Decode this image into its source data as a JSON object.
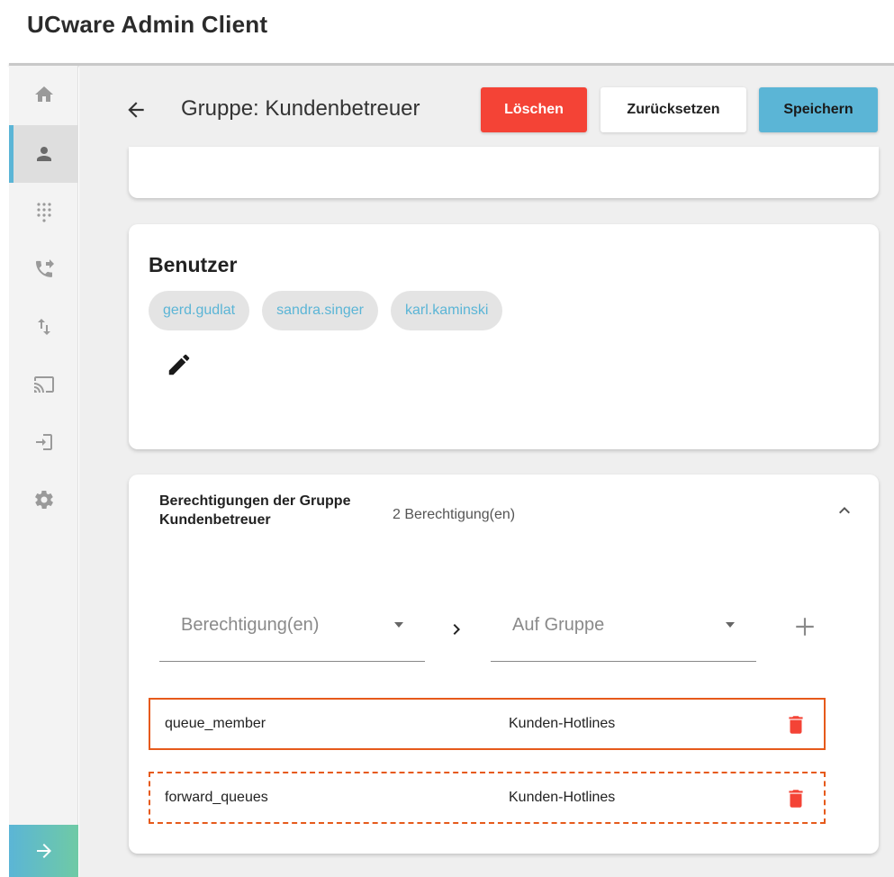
{
  "app": {
    "title": "UCware Admin Client"
  },
  "sidebar": {
    "items": [
      {
        "icon": "home-icon",
        "active": false
      },
      {
        "icon": "user-icon",
        "active": true
      },
      {
        "icon": "dialpad-icon",
        "active": false
      },
      {
        "icon": "phone-forward-icon",
        "active": false
      },
      {
        "icon": "swap-vert-icon",
        "active": false
      },
      {
        "icon": "cast-icon",
        "active": false
      },
      {
        "icon": "login-icon",
        "active": false
      },
      {
        "icon": "gear-icon",
        "active": false
      }
    ],
    "expand_icon": "arrow-right-icon"
  },
  "header": {
    "title": "Gruppe: Kundenbetreuer",
    "delete_label": "Löschen",
    "reset_label": "Zurücksetzen",
    "save_label": "Speichern"
  },
  "users_section": {
    "title": "Benutzer",
    "chips": [
      "gerd.gudlat",
      "sandra.singer",
      "karl.kaminski"
    ]
  },
  "permissions_section": {
    "title": "Berechtigungen der Gruppe Kundenbetreuer",
    "count": "2 Berechtigung(en)",
    "permission_select_label": "Berechtigung(en)",
    "group_select_label": "Auf Gruppe",
    "rows": [
      {
        "permission": "queue_member",
        "group": "Kunden-Hotlines"
      },
      {
        "permission": "forward_queues",
        "group": "Kunden-Hotlines"
      }
    ]
  },
  "colors": {
    "accent": "#5bb5d6",
    "danger": "#f44336",
    "highlight_border": "#e65a1b"
  }
}
